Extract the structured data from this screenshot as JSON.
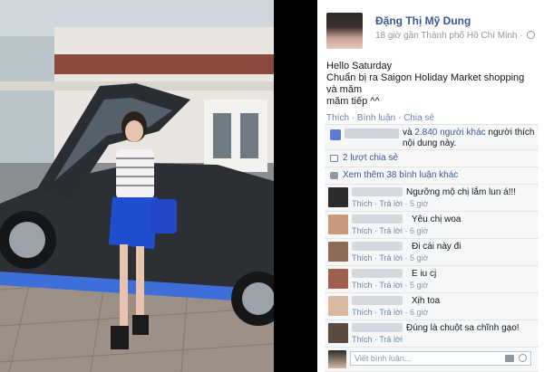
{
  "photo": {
    "colors": {
      "sky": "#b9c4cb",
      "car": "#2c2f33",
      "car_accent": "#3e6fd8",
      "wall": "#e9e6e1",
      "ground": "#9b8f86",
      "skirt": "#1f4fd0",
      "bag": "#2447c9"
    }
  },
  "post": {
    "author": "Đặng Thị Mỹ Dung",
    "meta": "18 giờ gần Thành phố Hồ Chí Minh ·",
    "text_lines": [
      "Hello Saturday",
      "Chuẩn bị ra Saigon Holiday Market shopping và măm",
      "măm tiếp ^^"
    ]
  },
  "actions": {
    "like": "Thích",
    "comment": "Bình luận",
    "share": "Chia sẻ",
    "sep": " · "
  },
  "ufi": {
    "likes_pre": "và ",
    "likes_link": "2.840 người khác",
    "likes_post": " người thích nội dung này.",
    "shares": "2 lượt chia sẻ",
    "more_comments": "Xem thêm 38 bình luận khác"
  },
  "comments": [
    {
      "text": "Ngưỡng mộ chị lắm lun á!!!",
      "like": "Thích",
      "reply": "Trả lời",
      "time": "5 giờ"
    },
    {
      "text": "Yêu chị woa",
      "like": "Thích",
      "reply": "Trả lời",
      "time": "6 giờ"
    },
    {
      "text": "Đi cái này đi",
      "like": "Thích",
      "reply": "Trả lời",
      "time": "5 giờ"
    },
    {
      "text": "E iu cj",
      "like": "Thích",
      "reply": "Trả lời",
      "time": "5 giờ"
    },
    {
      "text": "Xịh toa",
      "like": "Thích",
      "reply": "Trả lời",
      "time": "6 giờ"
    },
    {
      "text": "Đúng là chuột sa chĩnh gạo!",
      "like": "Thích",
      "reply": "Trả lời",
      "time": ""
    }
  ],
  "reply": {
    "placeholder": "Viết bình luận..."
  },
  "sep": " · "
}
